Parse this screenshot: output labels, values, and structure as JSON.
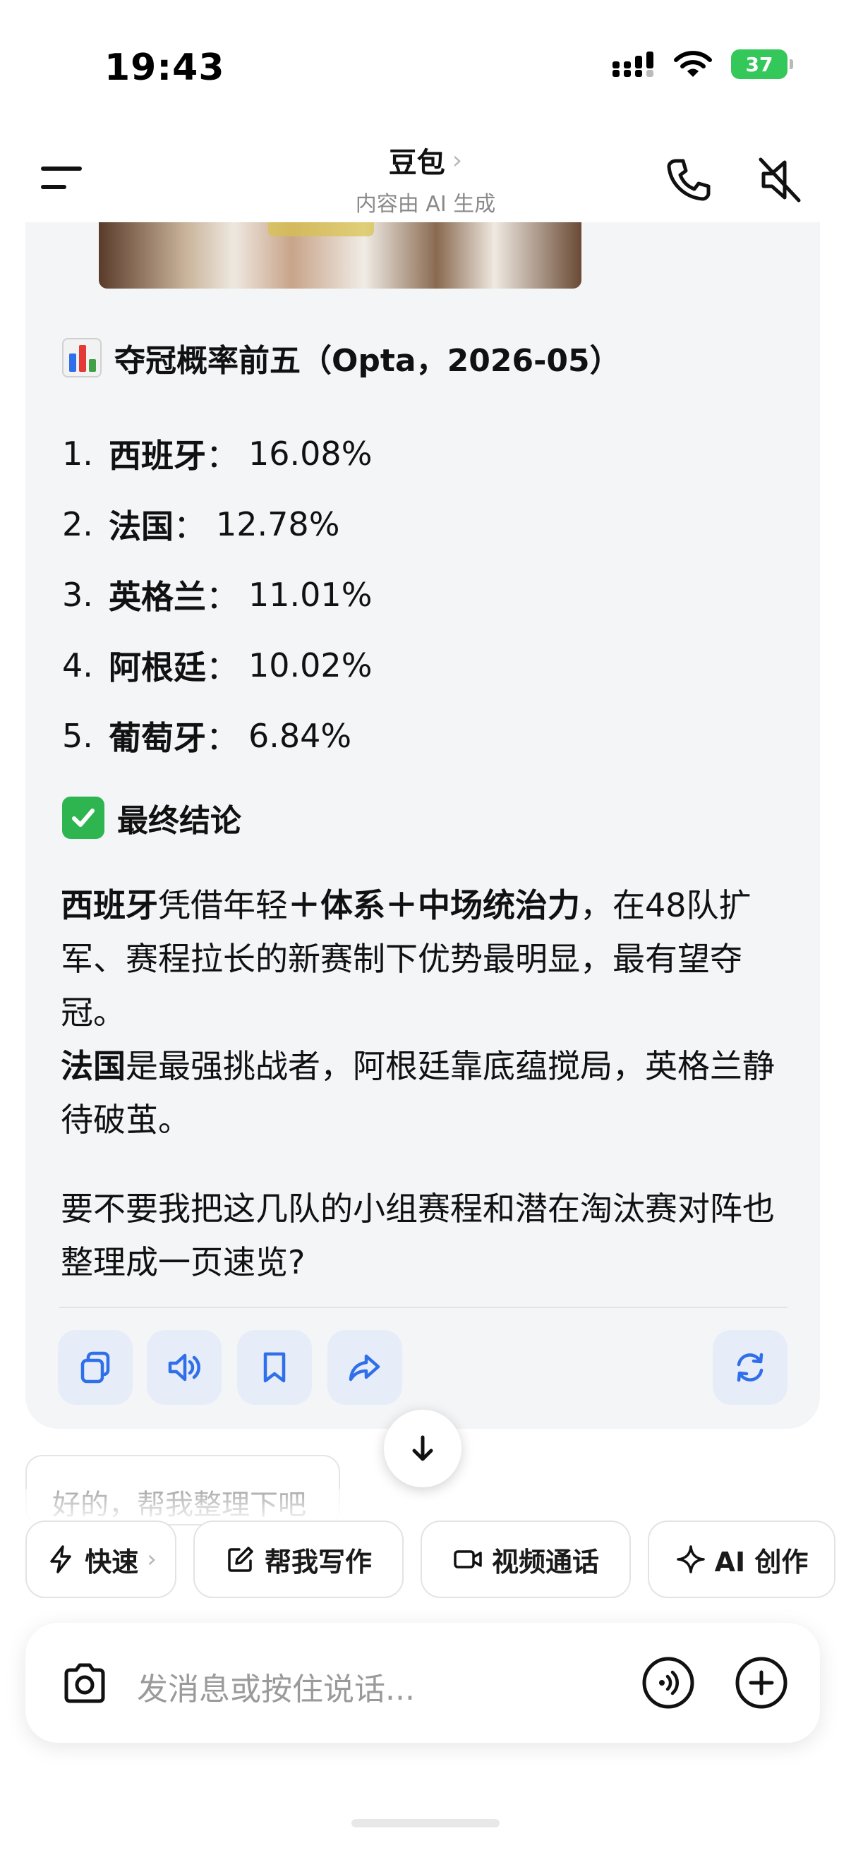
{
  "status_bar": {
    "time": "19:43",
    "battery": "37"
  },
  "header": {
    "title": "豆包",
    "subtitle": "内容由 AI 生成"
  },
  "section1": {
    "title": "夺冠概率前五（Opta，2026-05）",
    "icon": "bar-chart-emoji",
    "rankings": [
      {
        "num": "1.",
        "team": "西班牙",
        "sep": "：",
        "pct": "16.08%"
      },
      {
        "num": "2.",
        "team": "法国",
        "sep": "：",
        "pct": "12.78%"
      },
      {
        "num": "3.",
        "team": "英格兰",
        "sep": "：",
        "pct": "11.01%"
      },
      {
        "num": "4.",
        "team": "阿根廷",
        "sep": "：",
        "pct": "10.02%"
      },
      {
        "num": "5.",
        "team": "葡萄牙",
        "sep": "：",
        "pct": "6.84%"
      }
    ]
  },
  "section2": {
    "title": "最终结论",
    "icon": "check-mark-emoji",
    "p1": {
      "b1": "西班牙",
      "t1": "凭借年轻",
      "b2": "＋体系＋中场统治力",
      "t2": "，在48队扩军、赛程拉长的新赛制下优势最明显，最有望夺冠。"
    },
    "p2": {
      "b1": "法国",
      "t1": "是最强挑战者，阿根廷靠底蕴搅局，英格兰静待破茧。"
    }
  },
  "question": "要不要我把这几队的小组赛程和潜在淘汰赛对阵也整理成一页速览?",
  "actions": [
    "copy-icon",
    "speaker-icon",
    "bookmark-icon",
    "share-icon",
    "regenerate-icon"
  ],
  "suggestion": "好的，帮我整理下吧",
  "chips": {
    "fast": "快速",
    "write": "帮我写作",
    "video": "视频通话",
    "ai_create": "AI 创作"
  },
  "input": {
    "placeholder": "发消息或按住说话..."
  },
  "colors": {
    "accent": "#2f6fea",
    "action_bg": "#e6ecf8",
    "card_bg": "#f4f5f7",
    "battery": "#34c759"
  }
}
